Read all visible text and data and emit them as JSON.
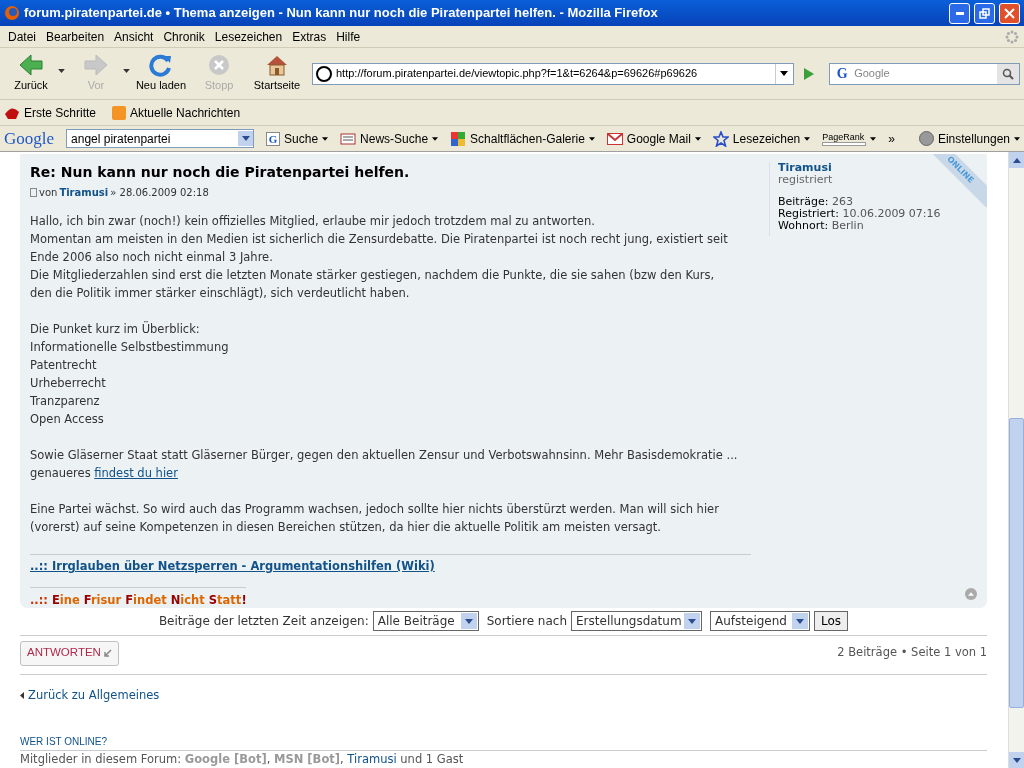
{
  "window": {
    "title": "forum.piratenpartei.de • Thema anzeigen - Nun kann nur noch die Piratenpartei helfen. - Mozilla Firefox"
  },
  "menu": [
    "Datei",
    "Bearbeiten",
    "Ansicht",
    "Chronik",
    "Lesezeichen",
    "Extras",
    "Hilfe"
  ],
  "nav_buttons": [
    {
      "kind": "back",
      "label": "Zurück",
      "disabled": false,
      "dropdown": true
    },
    {
      "kind": "forward",
      "label": "Vor",
      "disabled": true,
      "dropdown": true
    },
    {
      "kind": "reload",
      "label": "Neu laden",
      "disabled": false,
      "dropdown": false
    },
    {
      "kind": "stop",
      "label": "Stopp",
      "disabled": true,
      "dropdown": false
    },
    {
      "kind": "home",
      "label": "Startseite",
      "disabled": false,
      "dropdown": false
    }
  ],
  "address": "http://forum.piratenpartei.de/viewtopic.php?f=1&t=6264&p=69626#p69626",
  "search": {
    "engine_icon": "G",
    "placeholder": "Google"
  },
  "bookmarks": [
    {
      "kind": "pirate",
      "label": "Erste Schritte"
    },
    {
      "kind": "rss",
      "label": "Aktuelle Nachrichten"
    }
  ],
  "google_toolbar": {
    "logo": "Google",
    "query": "angel piratenpartei",
    "items": [
      {
        "kind": "search",
        "icon_text": "G",
        "label": "Suche"
      },
      {
        "kind": "news",
        "label": "News-Suche"
      },
      {
        "kind": "gallery",
        "label": "Schaltflächen-Galerie"
      },
      {
        "kind": "mail",
        "label": "Google Mail"
      },
      {
        "kind": "star",
        "label": "Lesezeichen"
      },
      {
        "kind": "pagerank",
        "label": "PageRank"
      }
    ],
    "more": "»",
    "settings": "Einstellungen"
  },
  "post": {
    "title": "Re: Nun kann nur noch die Piratenpartei helfen.",
    "by": "von",
    "author": "Tiramusi",
    "date": "» 28.06.2009 02:18",
    "paragraphs": [
      {
        "lines": [
          "Hallo, ich bin zwar (noch!) kein offizielles Mitglied, erlaube mir jedoch trotzdem mal zu antworten.",
          "Momentan am meisten in den Medien ist sicherlich die Zensurdebatte. Die Piratenpartei ist noch recht jung, existiert seit",
          "Ende 2006 also noch nicht einmal 3 Jahre.",
          "Die Mitgliederzahlen sind erst die letzten Monate stärker gestiegen, nachdem die Punkte, die sie sahen (bzw den Kurs,",
          "den die Politik immer stärker einschlägt), sich verdeutlicht haben."
        ]
      },
      {
        "lines": [
          "Die Punket kurz im Überblick:",
          "Informationelle Selbstbestimmung",
          "Patentrecht",
          "Urheberrecht",
          "Tranzparenz",
          "Open Access"
        ]
      },
      {
        "lines": [
          "Sowie Gläserner Staat statt Gläserner Bürger, gegen den aktuellen Zensur und Verbotswahnsinn. Mehr Basisdemokratie ...",
          "genaueres "
        ],
        "link": "findest du hier"
      },
      {
        "lines": [
          "Eine Partei wächst. So wird auch das Programm wachsen, jedoch sollte hier nichts überstürzt werden. Man will sich hier",
          "(vorerst) auf seine Kompetenzen in diesen Bereichen stützen, da hier die aktuelle Politik am meisten versagt."
        ]
      }
    ],
    "signature_link": "..:: Irrglauben über Netzsperren - Argumentationshilfen (Wiki)",
    "signature": [
      {
        "text": "..:: ",
        "color": "#cc3300"
      },
      {
        "text": "E",
        "color": "#990000"
      },
      {
        "text": "ine ",
        "color": "#dd6600"
      },
      {
        "text": "F",
        "color": "#990000"
      },
      {
        "text": "risur ",
        "color": "#dd6600"
      },
      {
        "text": "F",
        "color": "#990000"
      },
      {
        "text": "indet ",
        "color": "#dd6600"
      },
      {
        "text": "N",
        "color": "#990000"
      },
      {
        "text": "icht ",
        "color": "#dd6600"
      },
      {
        "text": "S",
        "color": "#990000"
      },
      {
        "text": "tatt",
        "color": "#dd6600"
      },
      {
        "text": "!",
        "color": "#990000"
      }
    ],
    "profile": {
      "name": "Tiramusi",
      "rank": "registriert",
      "online_badge": "ONLINE",
      "fields": [
        {
          "label": "Beiträge:",
          "value": "263"
        },
        {
          "label": "Registriert:",
          "value": "10.06.2009 07:16"
        },
        {
          "label": "Wohnort:",
          "value": "Berlin"
        }
      ]
    }
  },
  "sort_bar": {
    "label": "Beiträge der letzten Zeit anzeigen:",
    "days": "Alle Beiträge",
    "sort_label": "Sortiere nach",
    "sort_key": "Erstellungsdatum",
    "direction": "Aufsteigend",
    "go": "Los"
  },
  "reply_button": "ANTWORTEN",
  "pagination": "2 Beiträge • Seite 1 von 1",
  "back_link": "Zurück zu Allgemeines",
  "online": {
    "heading": "WER IST ONLINE?",
    "prefix": "Mitglieder in diesem Forum: ",
    "separator": ", ",
    "members": [
      {
        "name": "Google [Bot]",
        "kind": "bot"
      },
      {
        "name": "MSN [Bot]",
        "kind": "bot"
      },
      {
        "name": "Tiramusi",
        "kind": "user"
      }
    ],
    "suffix": " und 1 Gast"
  }
}
